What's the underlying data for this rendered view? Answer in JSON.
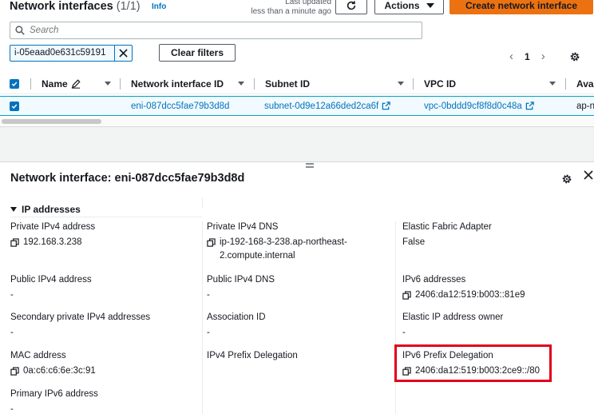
{
  "header": {
    "title": "Network interfaces",
    "count": "(1/1)",
    "info": "Info",
    "last_updated_line1": "Last updated",
    "last_updated_line2": "less than a minute ago",
    "actions_label": "Actions",
    "create_label": "Create network interface"
  },
  "search": {
    "placeholder": "Search"
  },
  "filter": {
    "token": "i-05eaad0e631c59191",
    "clear_label": "Clear filters"
  },
  "pagination": {
    "page": "1"
  },
  "table": {
    "columns": [
      "Name",
      "Network interface ID",
      "Subnet ID",
      "VPC ID",
      "Avai"
    ],
    "rows": [
      {
        "name": "",
        "eni_id": "eni-087dcc5fae79b3d8d",
        "subnet_id": "subnet-0d9e12a66ded2ca6f",
        "vpc_id": "vpc-0bddd9cf8f8d0c48a",
        "az": "ap-n"
      }
    ]
  },
  "details": {
    "title": "Network interface: eni-087dcc5fae79b3d8d",
    "section": "IP addresses",
    "fields": {
      "private_ipv4_label": "Private IPv4 address",
      "private_ipv4_value": "192.168.3.238",
      "private_dns_label": "Private IPv4 DNS",
      "private_dns_line1": "ip-192-168-3-238.ap-northeast-",
      "private_dns_line2": "2.compute.internal",
      "efa_label": "Elastic Fabric Adapter",
      "efa_value": "False",
      "public_ipv4_label": "Public IPv4 address",
      "public_ipv4_value": "-",
      "public_dns_label": "Public IPv4 DNS",
      "public_dns_value": "-",
      "ipv6_label": "IPv6 addresses",
      "ipv6_value": "2406:da12:519:b003::81e9",
      "secondary_label": "Secondary private IPv4 addresses",
      "secondary_value": "-",
      "assoc_label": "Association ID",
      "assoc_value": "-",
      "eip_owner_label": "Elastic IP address owner",
      "eip_owner_value": "-",
      "mac_label": "MAC address",
      "mac_value": "0a:c6:c6:6e:3c:91",
      "ipv4_prefix_label": "IPv4 Prefix Delegation",
      "ipv6_prefix_label": "IPv6 Prefix Delegation",
      "ipv6_prefix_value": "2406:da12:519:b003:2ce9::/80",
      "primary_ipv6_label": "Primary IPv6 address",
      "primary_ipv6_value": "-"
    }
  },
  "colors": {
    "link": "#0073bb",
    "primary_button": "#ec7211",
    "selected_row": "#f1faff",
    "highlight_box": "#e0001b"
  }
}
